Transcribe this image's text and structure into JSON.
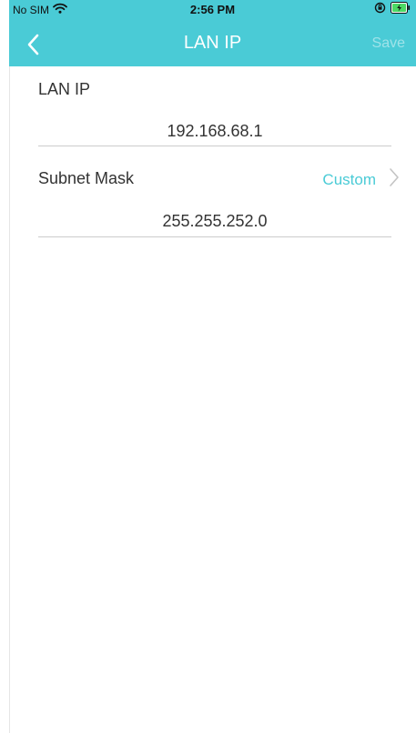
{
  "status_bar": {
    "carrier": "No SIM",
    "time": "2:56 PM"
  },
  "header": {
    "title": "LAN IP",
    "save_label": "Save"
  },
  "form": {
    "lan_ip": {
      "label": "LAN IP",
      "value": "192.168.68.1"
    },
    "subnet_mask": {
      "label": "Subnet Mask",
      "mode": "Custom",
      "value": "255.255.252.0"
    }
  },
  "colors": {
    "accent": "#4acbd6",
    "save_disabled": "#9fe3e9",
    "text": "#333333",
    "divider": "#cccccc"
  },
  "icons": [
    "wifi-icon",
    "orientation-lock-icon",
    "battery-charging-icon",
    "back-chevron-icon",
    "chevron-right-icon"
  ]
}
